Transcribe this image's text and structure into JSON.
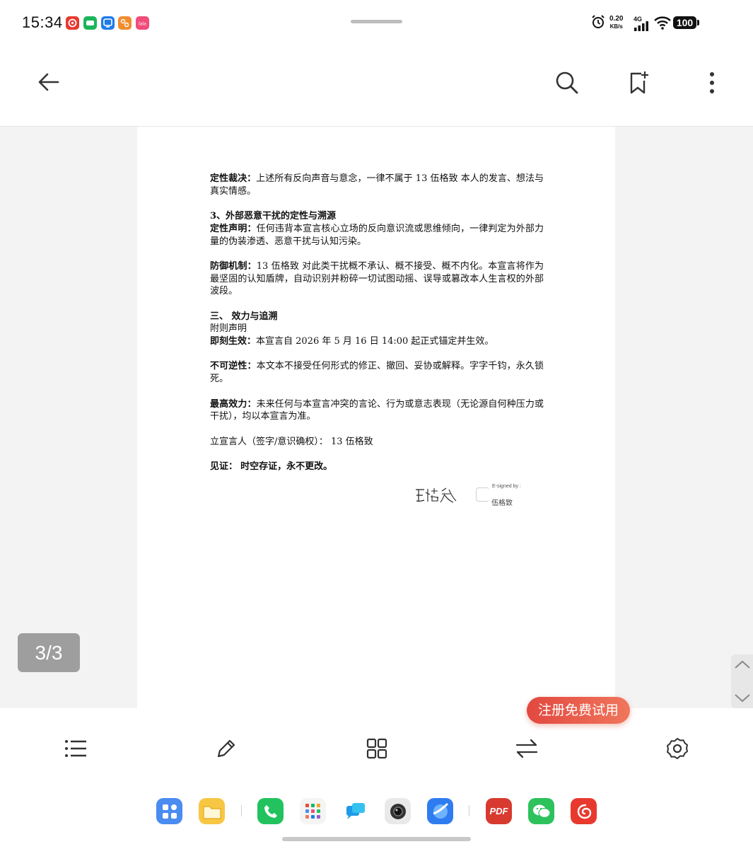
{
  "status_bar": {
    "time": "15:34",
    "net_speed_value": "0.20",
    "net_speed_unit": "KB/s",
    "network": "4G",
    "battery": "100"
  },
  "toolbar": {
    "back_icon": "arrow-left-icon",
    "search_icon": "search-icon",
    "bookmark_icon": "bookmark-add-icon",
    "more_icon": "more-vertical-icon"
  },
  "document": {
    "p1_label": "定性裁决：",
    "p1_text": "上述所有反向声音与意念，一律不属于 13 伍格致 本人的发言、想法与真实情感。",
    "h3_title": "3、外部恶意干扰的定性与溯源",
    "p2_label": "定性声明：",
    "p2_text": "任何违背本宣言核心立场的反向意识流或思维倾向，一律判定为外部力量的伪装渗透、恶意干扰与认知污染。",
    "p3_label": "防御机制：",
    "p3_text": "13 伍格致 对此类干扰概不承认、概不接受、概不内化。本宣言将作为最坚固的认知盾牌，自动识别并粉碎一切试图动摇、误导或篡改本人生言权的外部波段。",
    "section3_title": "三、 效力与追溯",
    "appendix": "附则声明",
    "p4_label": "即刻生效：",
    "p4_text": "本宣言自 2026 年 5 月 16 日 14:00 起正式锚定并生效。",
    "p5_label": "不可逆性：",
    "p5_text": "本文本不接受任何形式的修正、撤回、妥协或解释。字字千钧，永久锁死。",
    "p6_label": "最高效力：",
    "p6_text": "未来任何与本宣言冲突的言论、行为或意志表现（无论源自何种压力或干扰），均以本宣言为准。",
    "declarant": "立宣言人（签字/意识确权）：  13  伍格致",
    "witness_label": "见证：",
    "witness_text": "时空存证，永不更改。",
    "signature_handwriting": "伍格致",
    "esigned_label": "E-signed by :",
    "esigned_name": "伍格致"
  },
  "page_indicator": "3/3",
  "promo_button": "注册免费试用",
  "bottom_bar": {
    "outline_icon": "list-icon",
    "edit_icon": "pencil-icon",
    "thumbnails_icon": "grid-icon",
    "convert_icon": "swap-icon",
    "settings_icon": "settings-gear-icon"
  },
  "dock": {
    "pdf_label": "PDF"
  },
  "colors": {
    "accent_red": "#e2483f",
    "page_bg": "#f3f3f3",
    "text": "#111111"
  }
}
